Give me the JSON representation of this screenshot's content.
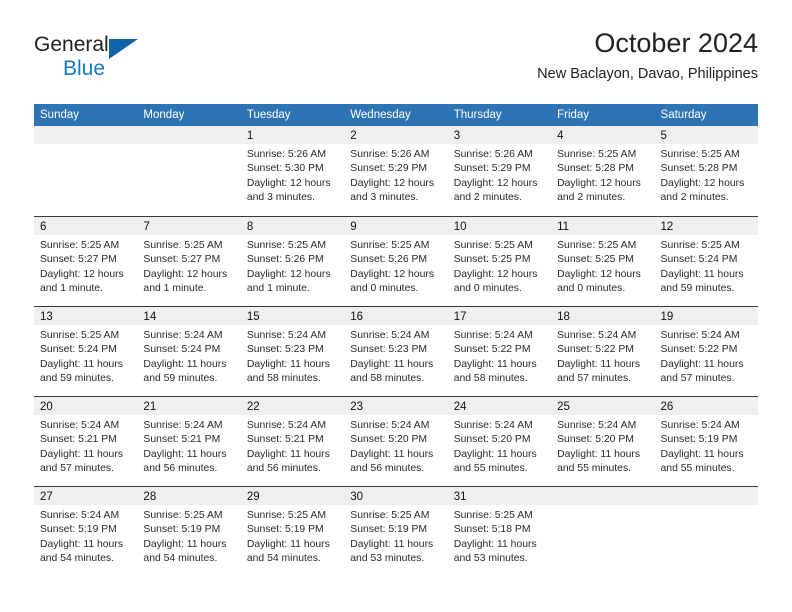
{
  "brand": {
    "name_part1": "General",
    "name_part2": "Blue",
    "triangle_color": "#1063a8",
    "blue_text_color": "#1878c8"
  },
  "header": {
    "title": "October 2024",
    "subtitle": "New Baclayon, Davao, Philippines"
  },
  "theme": {
    "header_blue": "#2e74b5",
    "date_band_gray": "#efefef",
    "row_divider": "#3a3a3a"
  },
  "weekdays": [
    "Sunday",
    "Monday",
    "Tuesday",
    "Wednesday",
    "Thursday",
    "Friday",
    "Saturday"
  ],
  "weeks": [
    [
      {
        "date": "",
        "lines": []
      },
      {
        "date": "",
        "lines": []
      },
      {
        "date": "1",
        "lines": [
          "Sunrise: 5:26 AM",
          "Sunset: 5:30 PM",
          "Daylight: 12 hours",
          "and 3 minutes."
        ]
      },
      {
        "date": "2",
        "lines": [
          "Sunrise: 5:26 AM",
          "Sunset: 5:29 PM",
          "Daylight: 12 hours",
          "and 3 minutes."
        ]
      },
      {
        "date": "3",
        "lines": [
          "Sunrise: 5:26 AM",
          "Sunset: 5:29 PM",
          "Daylight: 12 hours",
          "and 2 minutes."
        ]
      },
      {
        "date": "4",
        "lines": [
          "Sunrise: 5:25 AM",
          "Sunset: 5:28 PM",
          "Daylight: 12 hours",
          "and 2 minutes."
        ]
      },
      {
        "date": "5",
        "lines": [
          "Sunrise: 5:25 AM",
          "Sunset: 5:28 PM",
          "Daylight: 12 hours",
          "and 2 minutes."
        ]
      }
    ],
    [
      {
        "date": "6",
        "lines": [
          "Sunrise: 5:25 AM",
          "Sunset: 5:27 PM",
          "Daylight: 12 hours",
          "and 1 minute."
        ]
      },
      {
        "date": "7",
        "lines": [
          "Sunrise: 5:25 AM",
          "Sunset: 5:27 PM",
          "Daylight: 12 hours",
          "and 1 minute."
        ]
      },
      {
        "date": "8",
        "lines": [
          "Sunrise: 5:25 AM",
          "Sunset: 5:26 PM",
          "Daylight: 12 hours",
          "and 1 minute."
        ]
      },
      {
        "date": "9",
        "lines": [
          "Sunrise: 5:25 AM",
          "Sunset: 5:26 PM",
          "Daylight: 12 hours",
          "and 0 minutes."
        ]
      },
      {
        "date": "10",
        "lines": [
          "Sunrise: 5:25 AM",
          "Sunset: 5:25 PM",
          "Daylight: 12 hours",
          "and 0 minutes."
        ]
      },
      {
        "date": "11",
        "lines": [
          "Sunrise: 5:25 AM",
          "Sunset: 5:25 PM",
          "Daylight: 12 hours",
          "and 0 minutes."
        ]
      },
      {
        "date": "12",
        "lines": [
          "Sunrise: 5:25 AM",
          "Sunset: 5:24 PM",
          "Daylight: 11 hours",
          "and 59 minutes."
        ]
      }
    ],
    [
      {
        "date": "13",
        "lines": [
          "Sunrise: 5:25 AM",
          "Sunset: 5:24 PM",
          "Daylight: 11 hours",
          "and 59 minutes."
        ]
      },
      {
        "date": "14",
        "lines": [
          "Sunrise: 5:24 AM",
          "Sunset: 5:24 PM",
          "Daylight: 11 hours",
          "and 59 minutes."
        ]
      },
      {
        "date": "15",
        "lines": [
          "Sunrise: 5:24 AM",
          "Sunset: 5:23 PM",
          "Daylight: 11 hours",
          "and 58 minutes."
        ]
      },
      {
        "date": "16",
        "lines": [
          "Sunrise: 5:24 AM",
          "Sunset: 5:23 PM",
          "Daylight: 11 hours",
          "and 58 minutes."
        ]
      },
      {
        "date": "17",
        "lines": [
          "Sunrise: 5:24 AM",
          "Sunset: 5:22 PM",
          "Daylight: 11 hours",
          "and 58 minutes."
        ]
      },
      {
        "date": "18",
        "lines": [
          "Sunrise: 5:24 AM",
          "Sunset: 5:22 PM",
          "Daylight: 11 hours",
          "and 57 minutes."
        ]
      },
      {
        "date": "19",
        "lines": [
          "Sunrise: 5:24 AM",
          "Sunset: 5:22 PM",
          "Daylight: 11 hours",
          "and 57 minutes."
        ]
      }
    ],
    [
      {
        "date": "20",
        "lines": [
          "Sunrise: 5:24 AM",
          "Sunset: 5:21 PM",
          "Daylight: 11 hours",
          "and 57 minutes."
        ]
      },
      {
        "date": "21",
        "lines": [
          "Sunrise: 5:24 AM",
          "Sunset: 5:21 PM",
          "Daylight: 11 hours",
          "and 56 minutes."
        ]
      },
      {
        "date": "22",
        "lines": [
          "Sunrise: 5:24 AM",
          "Sunset: 5:21 PM",
          "Daylight: 11 hours",
          "and 56 minutes."
        ]
      },
      {
        "date": "23",
        "lines": [
          "Sunrise: 5:24 AM",
          "Sunset: 5:20 PM",
          "Daylight: 11 hours",
          "and 56 minutes."
        ]
      },
      {
        "date": "24",
        "lines": [
          "Sunrise: 5:24 AM",
          "Sunset: 5:20 PM",
          "Daylight: 11 hours",
          "and 55 minutes."
        ]
      },
      {
        "date": "25",
        "lines": [
          "Sunrise: 5:24 AM",
          "Sunset: 5:20 PM",
          "Daylight: 11 hours",
          "and 55 minutes."
        ]
      },
      {
        "date": "26",
        "lines": [
          "Sunrise: 5:24 AM",
          "Sunset: 5:19 PM",
          "Daylight: 11 hours",
          "and 55 minutes."
        ]
      }
    ],
    [
      {
        "date": "27",
        "lines": [
          "Sunrise: 5:24 AM",
          "Sunset: 5:19 PM",
          "Daylight: 11 hours",
          "and 54 minutes."
        ]
      },
      {
        "date": "28",
        "lines": [
          "Sunrise: 5:25 AM",
          "Sunset: 5:19 PM",
          "Daylight: 11 hours",
          "and 54 minutes."
        ]
      },
      {
        "date": "29",
        "lines": [
          "Sunrise: 5:25 AM",
          "Sunset: 5:19 PM",
          "Daylight: 11 hours",
          "and 54 minutes."
        ]
      },
      {
        "date": "30",
        "lines": [
          "Sunrise: 5:25 AM",
          "Sunset: 5:19 PM",
          "Daylight: 11 hours",
          "and 53 minutes."
        ]
      },
      {
        "date": "31",
        "lines": [
          "Sunrise: 5:25 AM",
          "Sunset: 5:18 PM",
          "Daylight: 11 hours",
          "and 53 minutes."
        ]
      },
      {
        "date": "",
        "lines": []
      },
      {
        "date": "",
        "lines": []
      }
    ]
  ]
}
